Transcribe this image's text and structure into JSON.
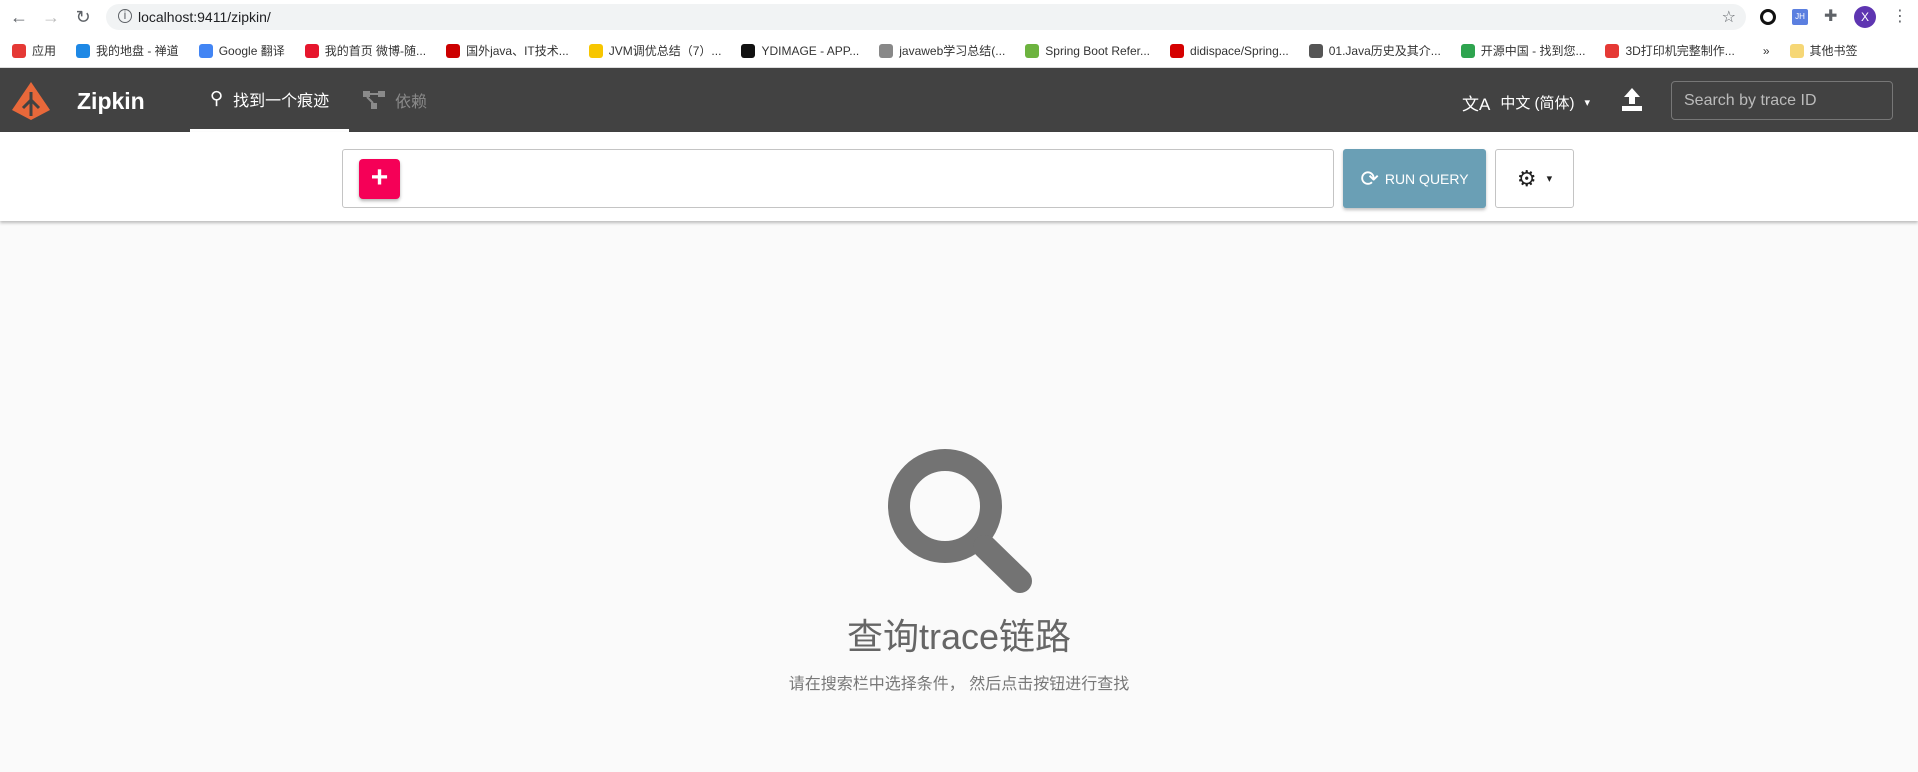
{
  "browser": {
    "url": "localhost:9411/zipkin/",
    "bookmarks": [
      {
        "label": "应用",
        "color": "#e53935"
      },
      {
        "label": "我的地盘 - 禅道",
        "color": "#1e88e5"
      },
      {
        "label": "Google 翻译",
        "color": "#4285f4"
      },
      {
        "label": "我的首页 微博-随...",
        "color": "#e6162d"
      },
      {
        "label": "国外java、IT技术...",
        "color": "#c00"
      },
      {
        "label": "JVM调优总结（7）...",
        "color": "#f7c600"
      },
      {
        "label": "YDIMAGE - APP...",
        "color": "#111"
      },
      {
        "label": "javaweb学习总结(...",
        "color": "#888"
      },
      {
        "label": "Spring Boot Refer...",
        "color": "#6db33f"
      },
      {
        "label": "didispace/Spring...",
        "color": "#d50000"
      },
      {
        "label": "01.Java历史及其介...",
        "color": "#555"
      },
      {
        "label": "开源中国 - 找到您...",
        "color": "#2ea44f"
      },
      {
        "label": "3D打印机完整制作...",
        "color": "#e53935"
      }
    ],
    "more": "»",
    "other_bookmarks": "其他书签",
    "profile_initial": "X"
  },
  "header": {
    "brand": "Zipkin",
    "tabs": [
      {
        "label": "找到一个痕迹",
        "active": true
      },
      {
        "label": "依赖",
        "active": false
      }
    ],
    "language": "中文 (简体)",
    "search_placeholder": "Search by trace ID"
  },
  "query": {
    "add_label": "+",
    "run_label": "RUN QUERY"
  },
  "empty_state": {
    "title": "查询trace链路",
    "subtitle": "请在搜索栏中选择条件， 然后点击按钮进行查找"
  },
  "colors": {
    "header": "#424242",
    "accent": "#f50057",
    "run": "#6a9fb5",
    "logo": "#e8683a"
  }
}
